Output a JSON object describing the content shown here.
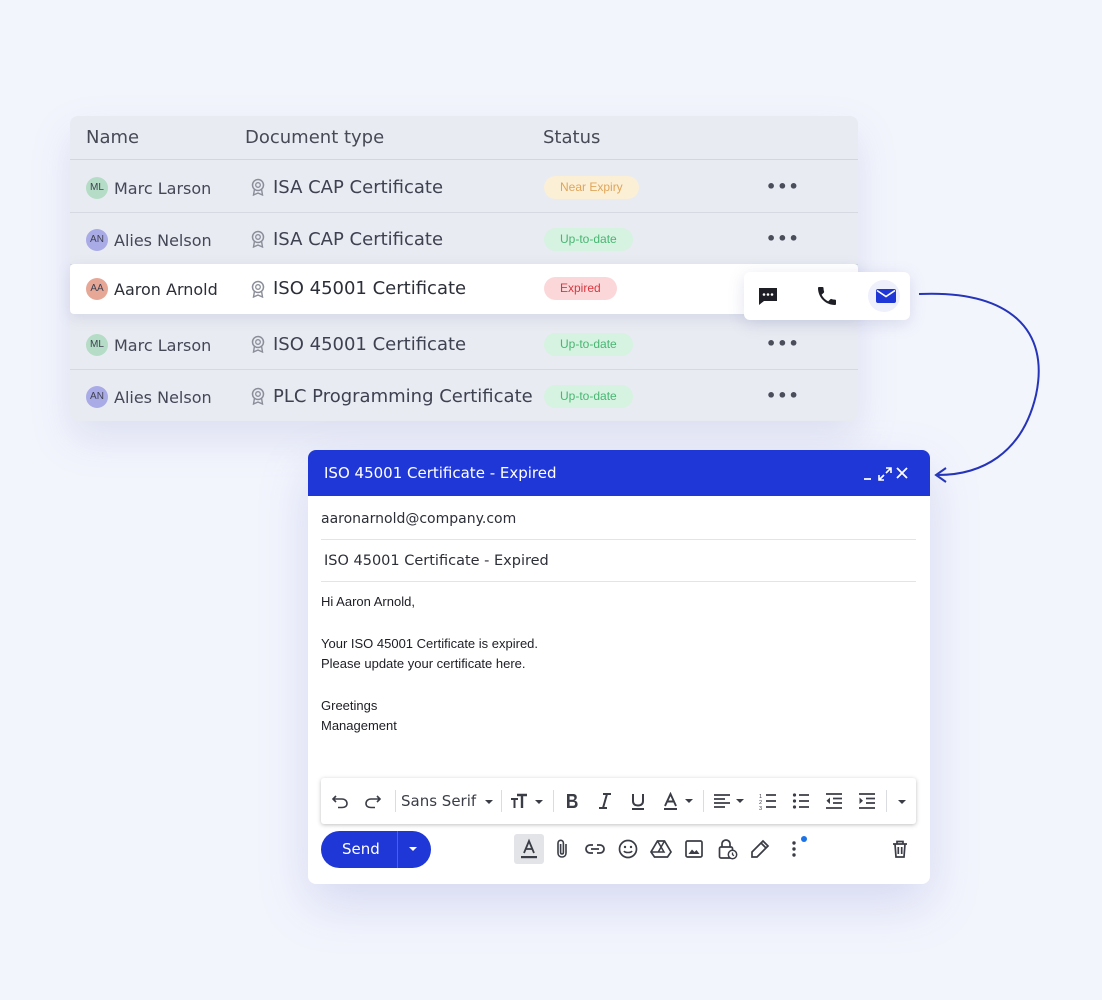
{
  "table": {
    "headers": {
      "name": "Name",
      "document_type": "Document type",
      "status": "Status"
    },
    "rows": [
      {
        "initials": "ML",
        "name": "Marc Larson",
        "document": "ISA CAP Certificate",
        "status": "Near Expiry"
      },
      {
        "initials": "AN",
        "name": "Alies Nelson",
        "document": "ISA CAP Certificate",
        "status": "Up-to-date"
      },
      {
        "initials": "AA",
        "name": "Aaron Arnold",
        "document": "ISO 45001 Certificate",
        "status": "Expired"
      },
      {
        "initials": "ML",
        "name": "Marc Larson",
        "document": "ISO 45001 Certificate",
        "status": "Up-to-date"
      },
      {
        "initials": "AN",
        "name": "Alies Nelson",
        "document": "PLC Programming Certificate",
        "status": "Up-to-date"
      }
    ],
    "more_label": "•••"
  },
  "action_popup": {
    "icons": [
      "chat-icon",
      "phone-icon",
      "mail-icon"
    ]
  },
  "compose": {
    "window_title": "ISO 45001 Certificate - Expired",
    "to": "aaronarnold@company.com",
    "subject": "ISO 45001 Certificate - Expired",
    "body": {
      "greeting": "Hi Aaron Arnold,",
      "line1": "Your ISO 45001 Certificate is expired.",
      "line2": "Please update your certificate here.",
      "sign1": "Greetings",
      "sign2": "Management"
    },
    "font_select": "Sans Serif",
    "send_label": "Send"
  },
  "colors": {
    "accent": "#1f37d6",
    "near_expiry_bg": "#fbefd6",
    "near_expiry_fg": "#e0a55a",
    "uptodate_bg": "#d6f2e0",
    "uptodate_fg": "#48b673",
    "expired_bg": "#fbd7d9",
    "expired_fg": "#d9373f"
  }
}
